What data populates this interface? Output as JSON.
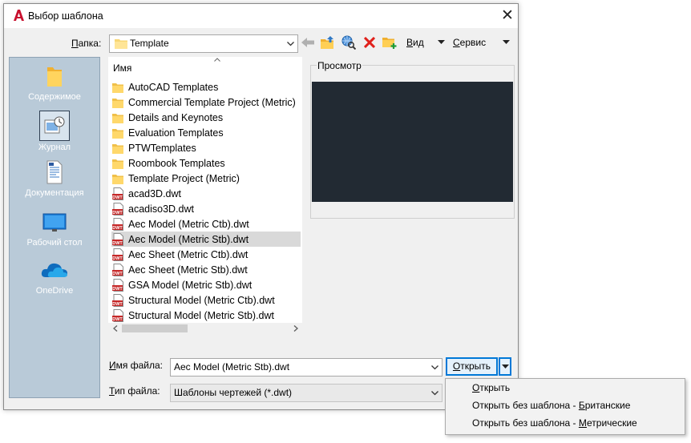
{
  "window": {
    "title": "Выбор шаблона",
    "close_label": "✕"
  },
  "folder": {
    "label_prefix": "",
    "label_accel": "П",
    "label_rest": "апка:",
    "value": "Template"
  },
  "toolbar": {
    "view_label": "Вид",
    "view_accel": "В",
    "view_rest": "ид",
    "tools_label": "Сервис",
    "tools_accel": "С",
    "tools_rest": "ервис"
  },
  "places": [
    {
      "label": "Содержимое",
      "icon": "folder-icon"
    },
    {
      "label": "Журнал",
      "icon": "history-icon"
    },
    {
      "label": "Документация",
      "icon": "documents-icon"
    },
    {
      "label": "Рабочий стол",
      "icon": "desktop-icon"
    },
    {
      "label": "OneDrive",
      "icon": "onedrive-icon"
    }
  ],
  "file_list": {
    "column_name": "Имя",
    "items": [
      {
        "name": "AutoCAD Templates",
        "type": "folder"
      },
      {
        "name": "Commercial Template Project (Metric)",
        "type": "folder"
      },
      {
        "name": "Details and Keynotes",
        "type": "folder"
      },
      {
        "name": "Evaluation Templates",
        "type": "folder"
      },
      {
        "name": "PTWTemplates",
        "type": "folder"
      },
      {
        "name": "Roombook Templates",
        "type": "folder"
      },
      {
        "name": "Template Project (Metric)",
        "type": "folder"
      },
      {
        "name": "acad3D.dwt",
        "type": "dwt"
      },
      {
        "name": "acadiso3D.dwt",
        "type": "dwt"
      },
      {
        "name": "Aec Model (Metric Ctb).dwt",
        "type": "dwt"
      },
      {
        "name": "Aec Model (Metric Stb).dwt",
        "type": "dwt",
        "selected": true
      },
      {
        "name": "Aec Sheet (Metric Ctb).dwt",
        "type": "dwt"
      },
      {
        "name": "Aec Sheet (Metric Stb).dwt",
        "type": "dwt"
      },
      {
        "name": "GSA Model (Metric Stb).dwt",
        "type": "dwt"
      },
      {
        "name": "Structural Model (Metric Ctb).dwt",
        "type": "dwt"
      },
      {
        "name": "Structural Model (Metric Stb).dwt",
        "type": "dwt"
      }
    ]
  },
  "preview": {
    "label": "Просмотр"
  },
  "filename": {
    "label_accel": "И",
    "label_rest": "мя файла:",
    "value": "Aec Model (Metric Stb).dwt"
  },
  "filetype": {
    "label_accel": "Т",
    "label_rest": "ип файла:",
    "value": "Шаблоны чертежей (*.dwt)"
  },
  "open_button": {
    "accel": "О",
    "rest": "ткрыть"
  },
  "open_menu": [
    {
      "label": "Открыть",
      "accel": "О",
      "before": "",
      "rest": "ткрыть"
    },
    {
      "label": "Открыть без шаблона - Британские",
      "before": "Открыть без шаблона - ",
      "accel": "Б",
      "rest": "ританские"
    },
    {
      "label": "Открыть без шаблона - Метрические",
      "before": "Открыть без шаблона - ",
      "accel": "М",
      "rest": "етрические"
    }
  ],
  "colors": {
    "accent": "#0078d7",
    "places_bg": "#b9cad8",
    "preview_bg": "#222a33",
    "selection": "#d9d9d9"
  }
}
